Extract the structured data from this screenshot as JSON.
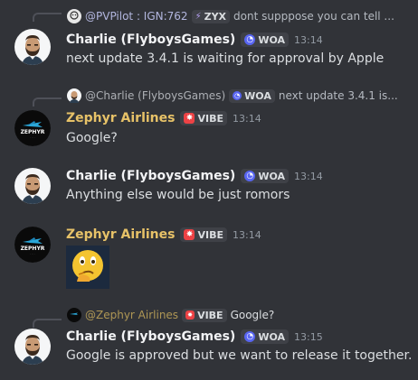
{
  "messages": {
    "m1": {
      "reply": {
        "name": "@PVPilot : IGN:762",
        "badge": "ZYX",
        "text": "dont supppose you can tell ..."
      },
      "author": "Charlie (FlyboysGames)",
      "badge": "WOA",
      "time": "13:14",
      "text": "next update 3.4.1 is waiting for approval by Apple"
    },
    "m2": {
      "reply": {
        "name": "@Charlie (FlyboysGames)",
        "badge": "WOA",
        "text": "next update 3.4.1 is..."
      },
      "author": "Zephyr Airlines",
      "badge": "VIBE",
      "time": "13:14",
      "text": "Google?"
    },
    "m3": {
      "author": "Charlie (FlyboysGames)",
      "badge": "WOA",
      "time": "13:14",
      "text": "Anything else would be just romors"
    },
    "m4": {
      "author": "Zephyr Airlines",
      "badge": "VIBE",
      "time": "13:14",
      "emoji": "thinking-face-emoji"
    },
    "m5": {
      "reply": {
        "name": "@Zephyr Airlines",
        "badge": "VIBE",
        "text": "Google?"
      },
      "author": "Charlie (FlyboysGames)",
      "badge": "WOA",
      "time": "13:15",
      "text": "Google is approved but we want to release it together."
    }
  },
  "avatars": {
    "zephyr_logo_text": "ZEPHYR"
  },
  "colors": {
    "background": "#313338",
    "zephyr_name": "#e7c268",
    "woa_badge": "#5865f2",
    "vibe_badge": "#ed4245"
  }
}
